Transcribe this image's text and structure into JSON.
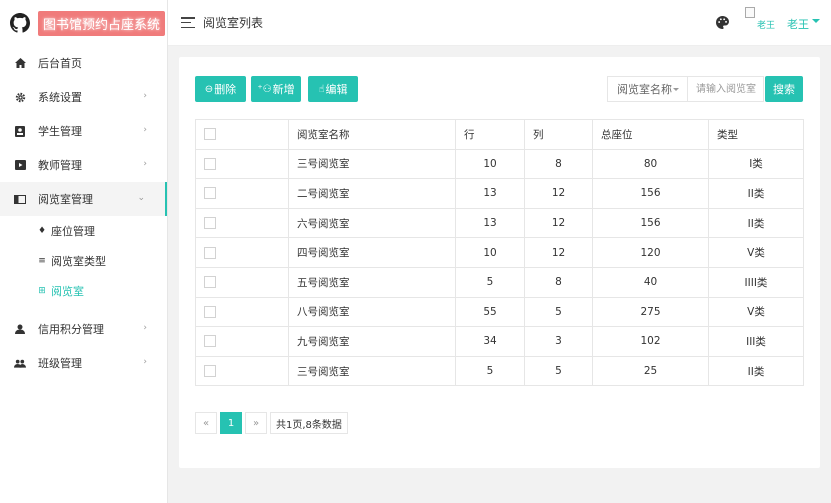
{
  "app": {
    "brand": "图书馆预约占座系统"
  },
  "header": {
    "title": "阅览室列表",
    "avatar_alt": "老王",
    "user_name": "老王"
  },
  "sidebar": {
    "items": [
      {
        "label": "后台首页",
        "icon": "home-icon"
      },
      {
        "label": "系统设置",
        "icon": "gear-icon"
      },
      {
        "label": "学生管理",
        "icon": "id-card-icon"
      },
      {
        "label": "教师管理",
        "icon": "video-card-icon"
      },
      {
        "label": "阅览室管理",
        "icon": "book-icon"
      },
      {
        "label": "信用积分管理",
        "icon": "person-icon"
      },
      {
        "label": "班级管理",
        "icon": "group-icon"
      }
    ],
    "submenu": [
      {
        "label": "座位管理",
        "icon": "seat-icon"
      },
      {
        "label": "阅览室类型",
        "icon": "list-icon"
      },
      {
        "label": "阅览室",
        "icon": "grid-icon"
      }
    ]
  },
  "toolbar": {
    "delete_label": "删除",
    "add_label": "新增",
    "edit_label": "编辑",
    "select_label": "阅览室名称",
    "search_placeholder": "请输入阅览室",
    "search_label": "搜索"
  },
  "table": {
    "headers": [
      "阅览室名称",
      "行",
      "列",
      "总座位",
      "类型"
    ],
    "rows": [
      [
        "三号阅览室",
        "10",
        "8",
        "80",
        "I类"
      ],
      [
        "二号阅览室",
        "13",
        "12",
        "156",
        "II类"
      ],
      [
        "六号阅览室",
        "13",
        "12",
        "156",
        "II类"
      ],
      [
        "四号阅览室",
        "10",
        "12",
        "120",
        "V类"
      ],
      [
        "五号阅览室",
        "5",
        "8",
        "40",
        "IIII类"
      ],
      [
        "八号阅览室",
        "55",
        "5",
        "275",
        "V类"
      ],
      [
        "九号阅览室",
        "34",
        "3",
        "102",
        "III类"
      ],
      [
        "三号阅览室",
        "5",
        "5",
        "25",
        "II类"
      ]
    ]
  },
  "pager": {
    "prev": "«",
    "current": "1",
    "next": "»",
    "info": "共1页,8条数据"
  },
  "colors": {
    "accent": "#26c2b2",
    "brand_bg": "#f07b7b"
  }
}
